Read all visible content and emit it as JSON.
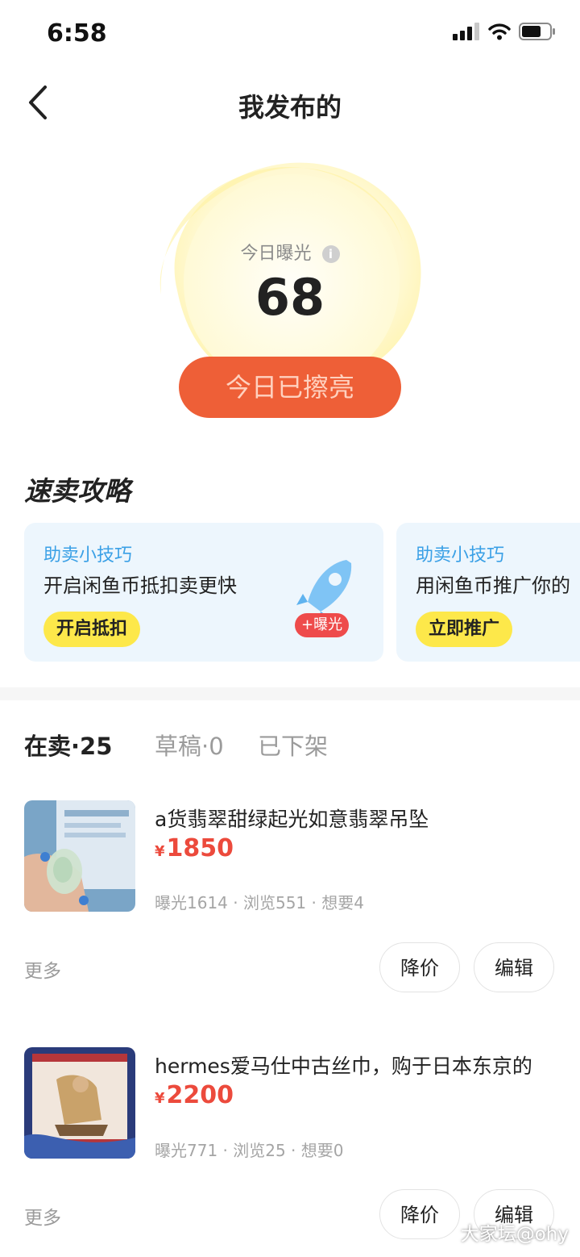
{
  "status_bar": {
    "time": "6:58"
  },
  "header": {
    "title": "我发布的"
  },
  "exposure": {
    "label": "今日曝光",
    "value": "68",
    "button": "今日已擦亮"
  },
  "tips": {
    "title": "速卖攻略",
    "cards": [
      {
        "small": "助卖小技巧",
        "main": "开启闲鱼币抵扣卖更快",
        "button": "开启抵扣",
        "badge": "+曝光"
      },
      {
        "small": "助卖小技巧",
        "main": "用闲鱼币推广你的",
        "button": "立即推广"
      }
    ]
  },
  "tabs": [
    "在卖·25",
    "草稿·0",
    "已下架"
  ],
  "items": [
    {
      "title": "a货翡翠甜绿起光如意翡翠吊坠",
      "currency": "¥",
      "price": "1850",
      "stats": "曝光1614 · 浏览551 · 想要4",
      "more": "更多",
      "btn_price": "降价",
      "btn_edit": "编辑"
    },
    {
      "title": "hermes爱马仕中古丝巾，购于日本东京的",
      "currency": "¥",
      "price": "2200",
      "stats": "曝光771 · 浏览25 · 想要0",
      "more": "更多",
      "btn_price": "降价",
      "btn_edit": "编辑"
    }
  ],
  "watermark": "大家坛@ohy",
  "colors": {
    "accent": "#ee5f37",
    "price": "#ec4a3c",
    "tip_blue": "#3aa0e6",
    "yellow": "#fde84a"
  }
}
